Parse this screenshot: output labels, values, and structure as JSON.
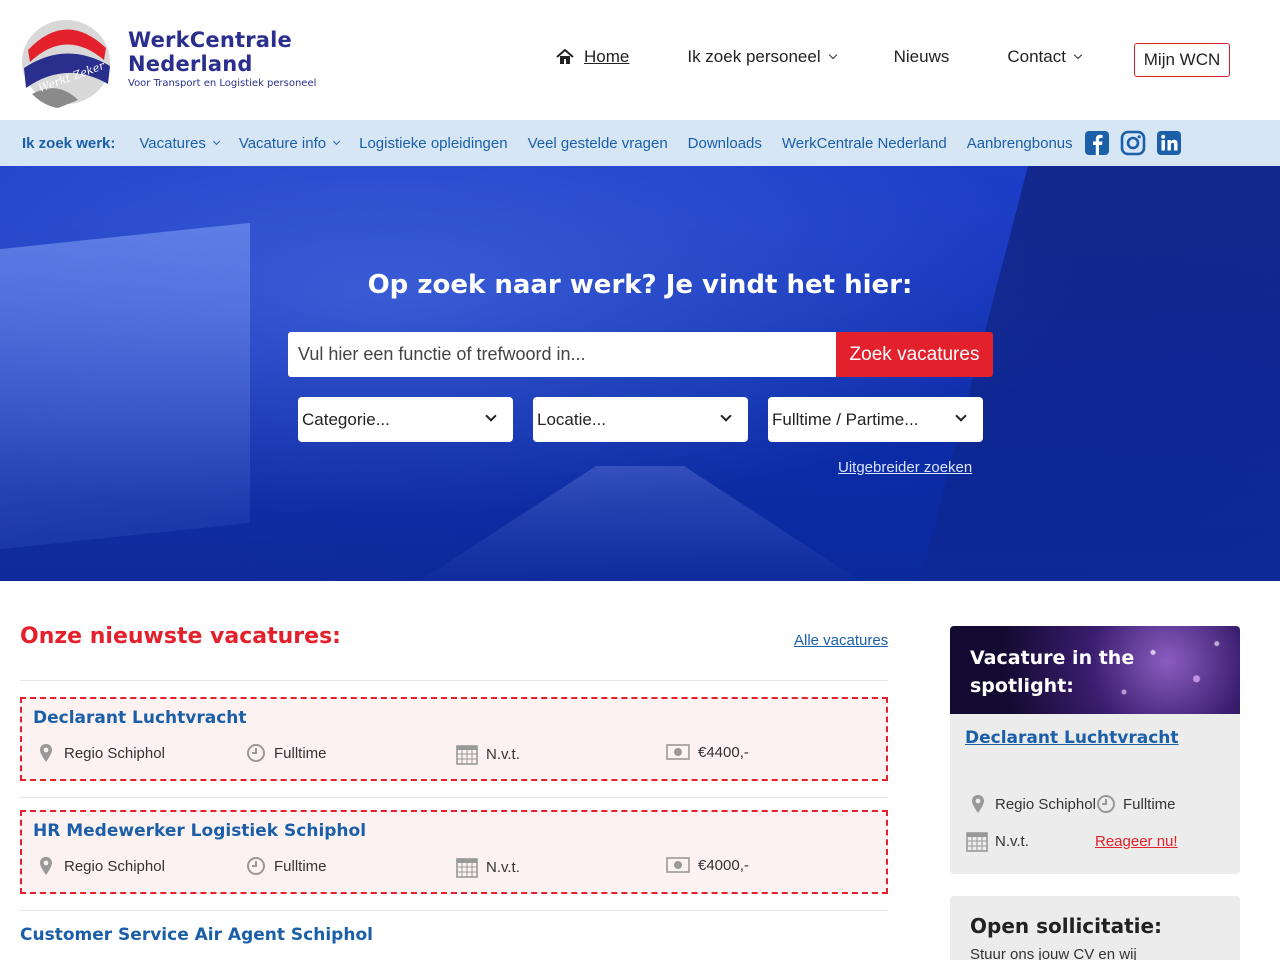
{
  "header": {
    "brand_line1": "WerkCentrale",
    "brand_line2": "Nederland",
    "tagline": "Voor Transport en Logistiek personeel",
    "logo_text": "Werkt Zeker",
    "nav": [
      {
        "label": "Home"
      },
      {
        "label": "Ik zoek personeel"
      },
      {
        "label": "Nieuws"
      },
      {
        "label": "Contact"
      }
    ],
    "account_button": "Mijn WCN"
  },
  "subnav": {
    "lead": "Ik zoek werk:",
    "items": [
      {
        "label": "Vacatures"
      },
      {
        "label": "Vacature info"
      },
      {
        "label": "Logistieke opleidingen"
      },
      {
        "label": "Veel gestelde vragen"
      },
      {
        "label": "Downloads"
      },
      {
        "label": "WerkCentrale Nederland"
      },
      {
        "label": "Aanbrengbonus"
      }
    ],
    "social": [
      "facebook-icon",
      "instagram-icon",
      "linkedin-icon"
    ]
  },
  "hero": {
    "title": "Op zoek naar werk? Je vindt het hier:",
    "search_placeholder": "Vul hier een functie of trefwoord in...",
    "search_button": "Zoek vacatures",
    "filters": [
      "Categorie...",
      "Locatie...",
      "Fulltime / Partime..."
    ],
    "advanced_link": "Uitgebreider zoeken"
  },
  "jobs_section": {
    "title": "Onze nieuwste vacatures:",
    "all_link": "Alle vacatures",
    "jobs": [
      {
        "title": "Declarant Luchtvracht",
        "location": "Regio Schiphol",
        "hours": "Fulltime",
        "date": "N.v.t.",
        "salary": "€4400,-"
      },
      {
        "title": "HR Medewerker Logistiek Schiphol",
        "location": "Regio Schiphol",
        "hours": "Fulltime",
        "date": "N.v.t.",
        "salary": "€4000,-"
      },
      {
        "title": "Customer Service Air Agent Schiphol"
      }
    ]
  },
  "spotlight": {
    "title": "Vacature in the spotlight:",
    "job_title": "Declarant Luchtvracht",
    "location": "Regio Schiphol",
    "hours": "Fulltime",
    "date": "N.v.t.",
    "react_link": "Reageer nu!"
  },
  "open_application": {
    "title": "Open sollicitatie:",
    "text": "Stuur ons jouw CV en wij"
  },
  "colors": {
    "brand_blue": "#2a2f8e",
    "link_blue": "#1b5fa8",
    "accent_red": "#e3212d",
    "subnav_bg": "#d6e6f5"
  }
}
